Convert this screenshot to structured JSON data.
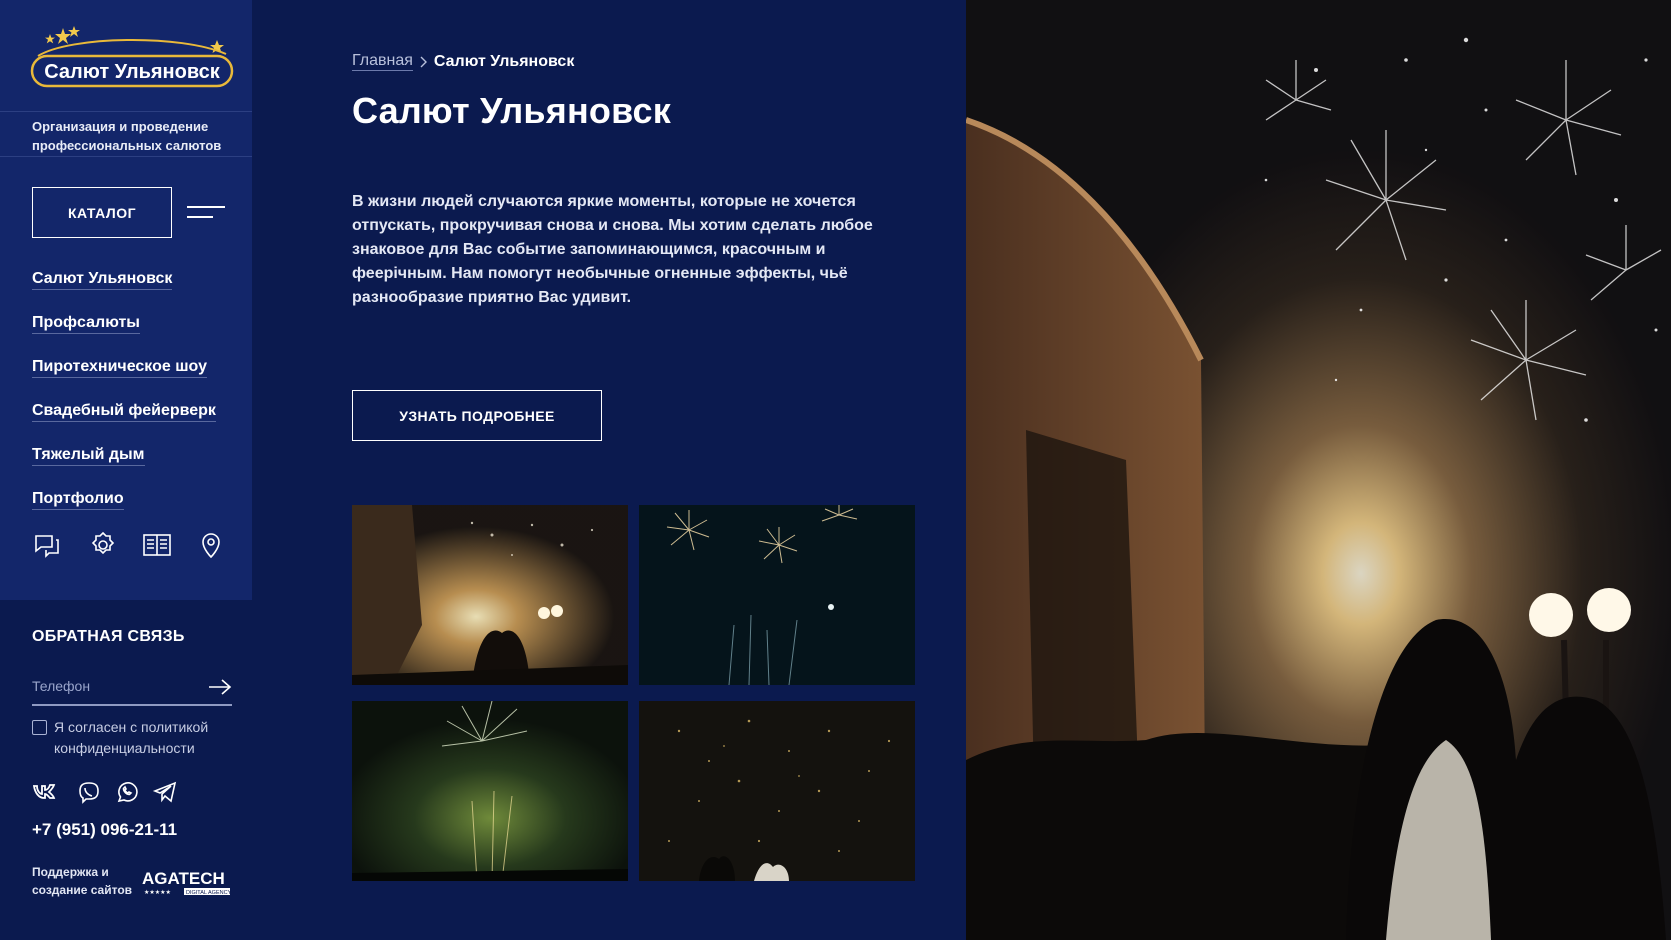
{
  "brand": {
    "logo_text": "Салют Ульяновск",
    "tagline_lines": [
      "Организация и проведение",
      "профессиональных салютов"
    ]
  },
  "sidebar": {
    "catalog_label": "КАТАЛОГ",
    "nav": [
      {
        "label": "Салют Ульяновск"
      },
      {
        "label": "Профсалюты"
      },
      {
        "label": "Пиротехническое шоу"
      },
      {
        "label": "Свадебный фейерверк"
      },
      {
        "label": "Тяжелый дым"
      },
      {
        "label": "Портфолио"
      }
    ],
    "quick_icons": [
      "reviews-icon",
      "settings-badge-icon",
      "book-icon",
      "location-pin-icon"
    ]
  },
  "feedback": {
    "title": "ОБРАТНАЯ СВЯЗЬ",
    "phone_placeholder": "Телефон",
    "consent_lines": [
      "Я согласен с политикой",
      "конфиденциальности"
    ],
    "socials": [
      "vk-icon",
      "viber-icon",
      "whatsapp-icon",
      "telegram-icon"
    ],
    "phone": "+7 (951) 096-21-11"
  },
  "footer": {
    "support_lines": [
      "Поддержка и",
      "создание сайтов"
    ],
    "agency_name": "AGATECH",
    "agency_sub": "DIGITAL AGENCY"
  },
  "main": {
    "breadcrumb": {
      "home": "Главная",
      "current": "Салют Ульяновск"
    },
    "title": "Салют Ульяновск",
    "intro_lines": [
      "В жизни людей случаются яркие моменты, которые не хочется",
      "отпускать, прокручивая снова и снова. Мы хотим сделать любое",
      "знаковое для Вас событие запоминающимся, красочным и",
      "феерічным. Нам помогут необычные огненные эффекты, чьё",
      "разнообразие приятно Вас удивит."
    ],
    "more_button": "УЗНАТЬ ПОДРОБНЕЕ"
  },
  "colors": {
    "background": "#0b1a4f",
    "sidebar_panel": "#13266a",
    "logo_gold": "#e9b93a",
    "text": "#ffffff"
  }
}
